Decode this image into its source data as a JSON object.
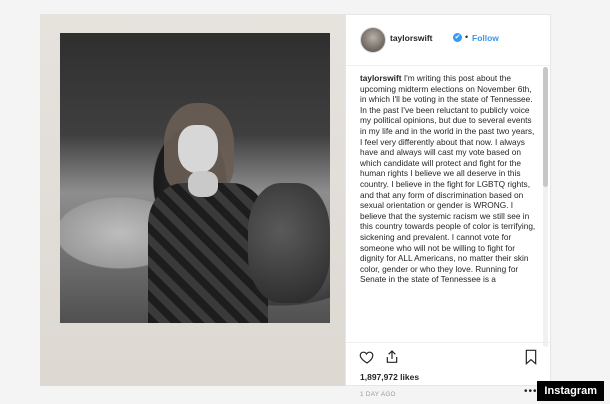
{
  "post": {
    "username": "taylorswift",
    "verified_symbol": "✔",
    "separator": "•",
    "follow_label": "Follow",
    "caption_user": "taylorswift",
    "caption_text": "I'm writing this post about the upcoming midterm elections on November 6th, in which I'll be voting in the state of Tennessee. In the past I've been reluctant to publicly voice my political opinions, but due to several events in my life and in the world in the past two years, I feel very differently about that now. I always have and always will cast my vote based on which candidate will protect and fight for the human rights I believe we all deserve in this country. I believe in the fight for LGBTQ rights, and that any form of discrimination based on sexual orientation or gender is WRONG. I believe that the systemic racism we still see in this country towards people of color is terrifying, sickening and prevalent. I cannot vote for someone who will not be willing to fight for dignity for ALL Americans, no matter their skin color, gender or who they love. Running for Senate in the state of Tennessee is a",
    "likes": "1,897,972 likes",
    "timestamp": "1 DAY AGO",
    "more_symbol": "•••"
  },
  "icons": {
    "heart": "heart-icon",
    "share": "share-icon",
    "bookmark": "bookmark-icon",
    "more": "more-icon",
    "verified": "verified-icon"
  },
  "colors": {
    "accent": "#3897f0",
    "text": "#262626",
    "muted": "#999999"
  },
  "watermark": "Instagram"
}
